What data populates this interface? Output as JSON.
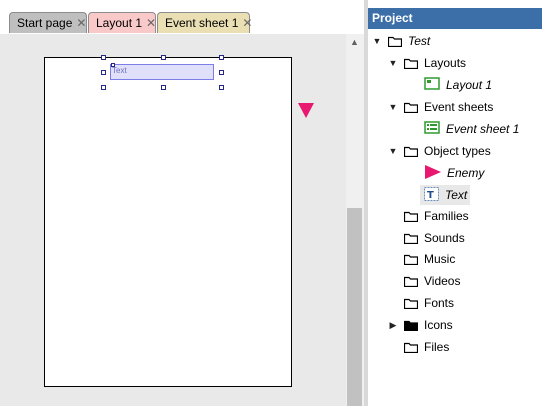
{
  "tabs": [
    {
      "label": "Start page",
      "close": "✕"
    },
    {
      "label": "Layout 1",
      "close": "✕"
    },
    {
      "label": "Event sheet 1",
      "close": "✕"
    }
  ],
  "canvas": {
    "text_object_label": "Text"
  },
  "scrollbar": {
    "up_arrow": "▲"
  },
  "project": {
    "title": "Project",
    "root": {
      "label": "Test",
      "expander": "▼"
    },
    "layouts": {
      "label": "Layouts",
      "expander": "▼",
      "items": [
        {
          "label": "Layout 1",
          "icon": "layout-icon"
        }
      ]
    },
    "event_sheets": {
      "label": "Event sheets",
      "expander": "▼",
      "items": [
        {
          "label": "Event sheet 1",
          "icon": "event-sheet-icon"
        }
      ]
    },
    "object_types": {
      "label": "Object types",
      "expander": "▼",
      "items": [
        {
          "label": "Enemy",
          "icon": "sprite-icon"
        },
        {
          "label": "Text",
          "icon": "text-object-icon"
        }
      ]
    },
    "folders": [
      {
        "label": "Families"
      },
      {
        "label": "Sounds"
      },
      {
        "label": "Music"
      },
      {
        "label": "Videos"
      },
      {
        "label": "Fonts"
      }
    ],
    "icons": {
      "label": "Icons",
      "expander": "▶"
    },
    "files": {
      "label": "Files"
    }
  },
  "colors": {
    "project_header": "#3c6fa8",
    "sprite_pink": "#e8176f",
    "tab_layout": "#f9c9c9",
    "tab_events": "#e9dfb3"
  }
}
